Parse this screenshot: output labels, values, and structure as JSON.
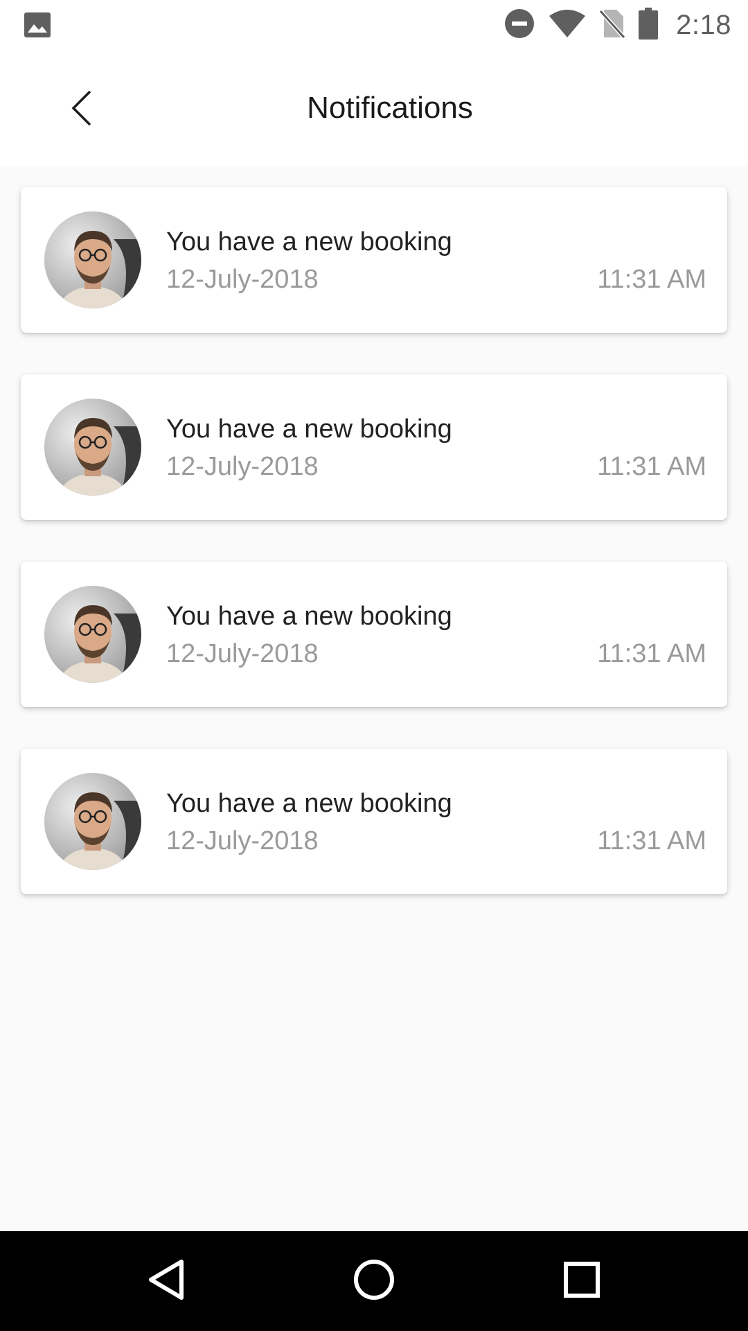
{
  "status_bar": {
    "time": "2:18",
    "icons": [
      "gallery-icon",
      "do-not-disturb-icon",
      "wifi-icon",
      "no-sim-icon",
      "battery-icon"
    ]
  },
  "app_bar": {
    "title": "Notifications",
    "back_icon": "chevron-left-icon"
  },
  "notifications": [
    {
      "title": "You have a new booking",
      "date": "12-July-2018",
      "time": "11:31 AM"
    },
    {
      "title": "You have a new booking",
      "date": "12-July-2018",
      "time": "11:31 AM"
    },
    {
      "title": "You have a new booking",
      "date": "12-July-2018",
      "time": "11:31 AM"
    },
    {
      "title": "You have a new booking",
      "date": "12-July-2018",
      "time": "11:31 AM"
    }
  ],
  "nav_bar": {
    "icons": [
      "back-triangle-icon",
      "home-circle-icon",
      "recents-square-icon"
    ]
  },
  "colors": {
    "background": "#fafafa",
    "surface": "#ffffff",
    "title_text": "#222222",
    "secondary_text": "#9a9a9a",
    "nav_bar": "#000000"
  }
}
